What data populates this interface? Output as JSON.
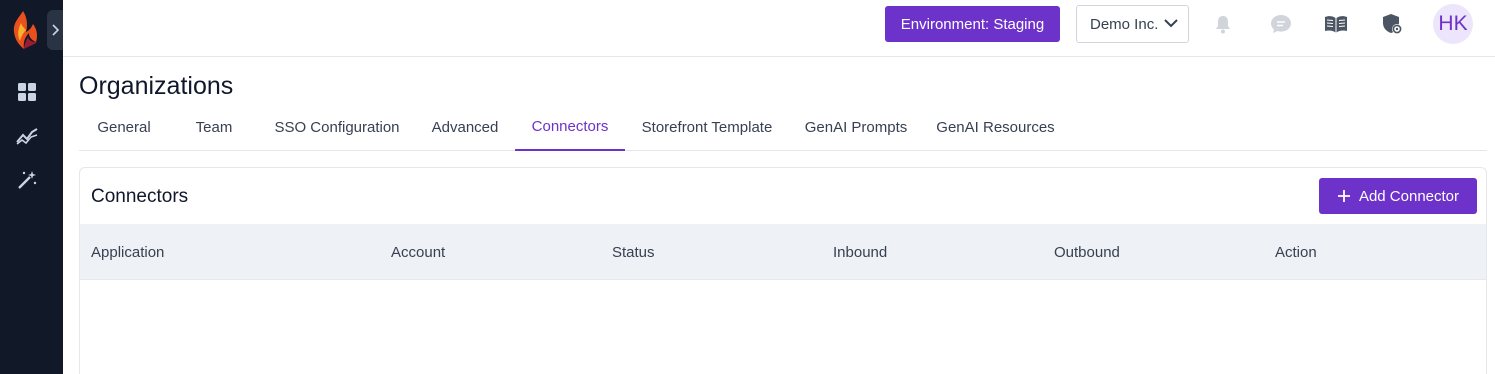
{
  "topbar": {
    "environment_label": "Environment: Staging",
    "org_selector_value": "Demo Inc.",
    "avatar_initials": "HK"
  },
  "sidebar": {
    "icons": [
      "dashboard-icon",
      "analytics-icon",
      "magic-wand-icon"
    ]
  },
  "page": {
    "title": "Organizations"
  },
  "tabs": [
    {
      "label": "General",
      "active": false
    },
    {
      "label": "Team",
      "active": false
    },
    {
      "label": "SSO Configuration",
      "active": false
    },
    {
      "label": "Advanced",
      "active": false
    },
    {
      "label": "Connectors",
      "active": true
    },
    {
      "label": "Storefront Template",
      "active": false
    },
    {
      "label": "GenAI Prompts",
      "active": false
    },
    {
      "label": "GenAI Resources",
      "active": false
    }
  ],
  "connectors": {
    "title": "Connectors",
    "add_button_label": "Add Connector",
    "columns": [
      "Application",
      "Account",
      "Status",
      "Inbound",
      "Outbound",
      "Action"
    ],
    "rows": []
  },
  "colors": {
    "accent": "#6d32c9",
    "sidebar_bg": "#111827",
    "table_header_bg": "#eef1f5"
  }
}
